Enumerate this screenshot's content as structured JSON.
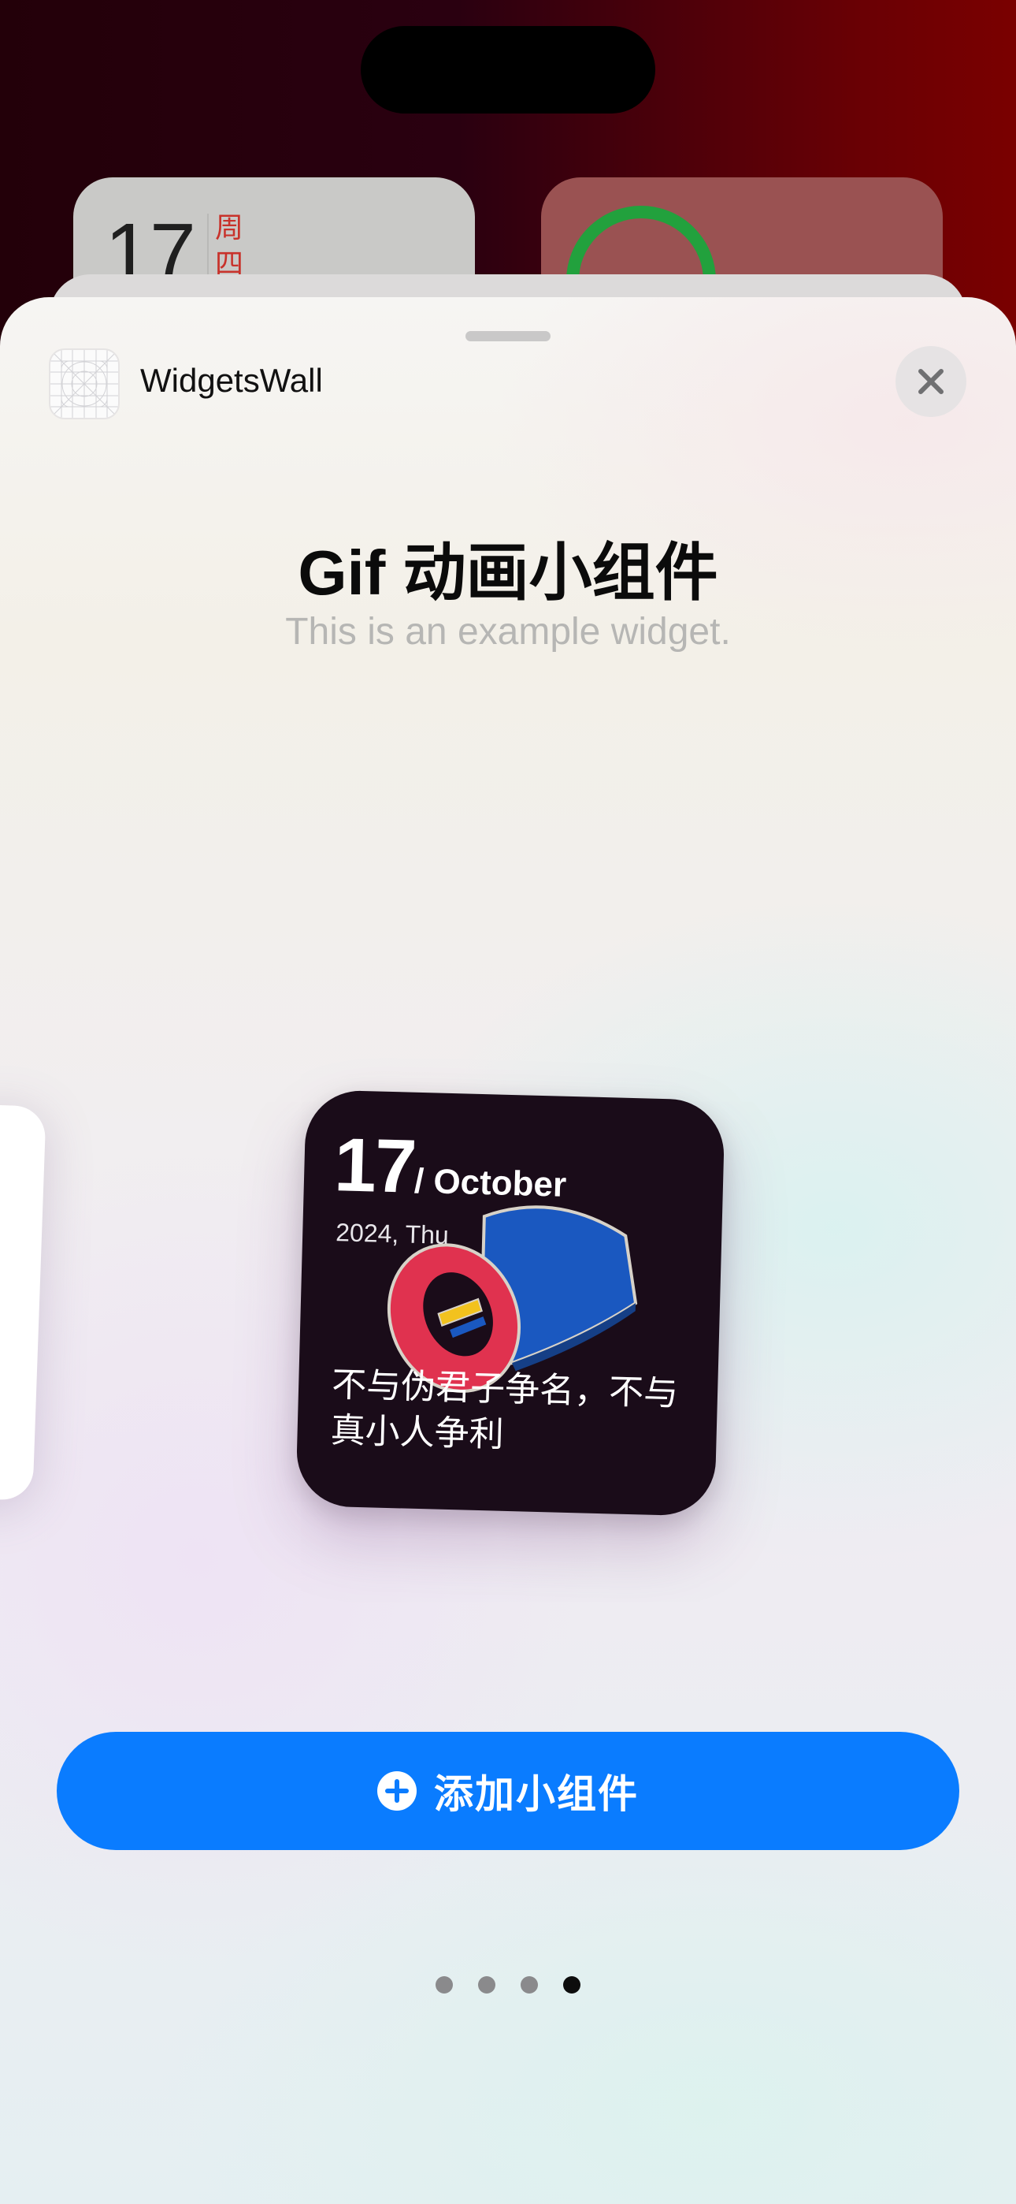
{
  "home_widgets": {
    "calendar": {
      "day": "17",
      "weekday": "周四"
    }
  },
  "sheet": {
    "app_name": "WidgetsWall",
    "title": "Gif 动画小组件",
    "subtitle": "This is an example widget.",
    "icons": {
      "app": "widgetswall-app-icon",
      "close": "close-icon",
      "add": "plus-circle-icon"
    }
  },
  "widget": {
    "day": "17",
    "month": "/ October",
    "year_weekday": "2024, Thu",
    "quote": "不与伪君子争名，不与真小人争利",
    "colors": {
      "background": "#1a0c19",
      "text": "#ffffff"
    }
  },
  "pager": {
    "count": 4,
    "active_index": 3
  },
  "add_button": {
    "label": "添加小组件",
    "color": "#0a7cff"
  }
}
